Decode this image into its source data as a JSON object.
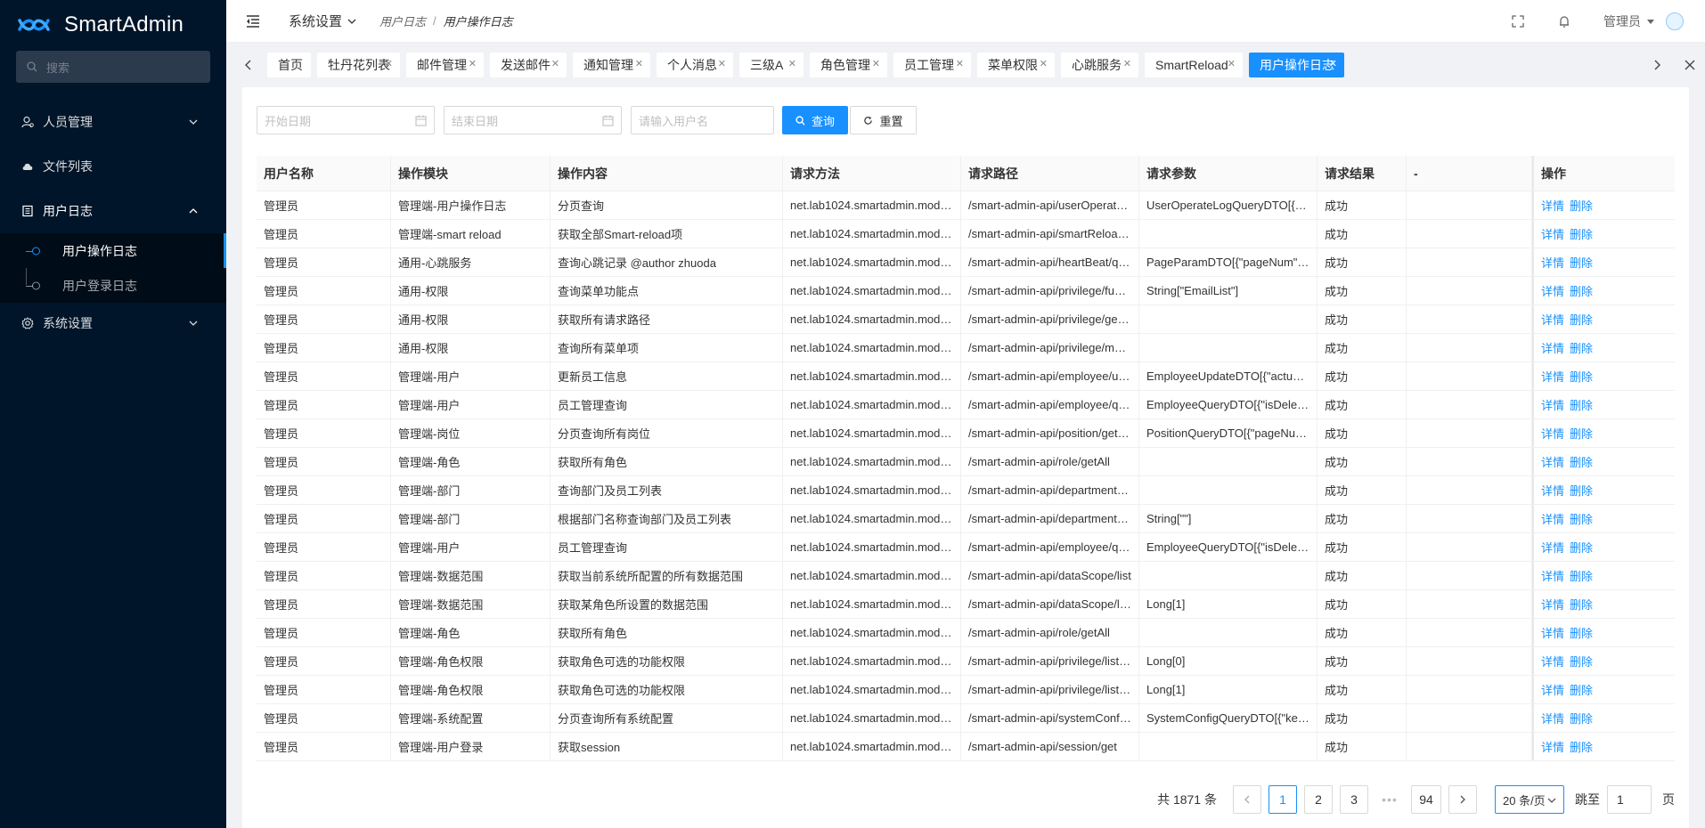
{
  "app": {
    "name": "SmartAdmin"
  },
  "sidebar": {
    "search_placeholder": "搜索",
    "menu": [
      {
        "label": "人员管理",
        "icon": "user-icon",
        "expanded": false
      },
      {
        "label": "文件列表",
        "icon": "cloud-icon"
      },
      {
        "label": "用户日志",
        "icon": "book-icon",
        "expanded": true
      },
      {
        "label": "系统设置",
        "icon": "gear-icon",
        "expanded": false
      }
    ],
    "submenu": [
      {
        "label": "用户操作日志",
        "active": true
      },
      {
        "label": "用户登录日志",
        "active": false
      }
    ]
  },
  "header": {
    "menu_label": "系统设置",
    "breadcrumb": [
      "用户日志",
      "用户操作日志"
    ],
    "user_name": "管理员"
  },
  "tabs": [
    {
      "label": "首页",
      "closable": false
    },
    {
      "label": "牡丹花列表",
      "closable": true
    },
    {
      "label": "邮件管理",
      "closable": true
    },
    {
      "label": "发送邮件",
      "closable": true
    },
    {
      "label": "通知管理",
      "closable": true
    },
    {
      "label": "个人消息",
      "closable": true
    },
    {
      "label": "三级A",
      "closable": true
    },
    {
      "label": "角色管理",
      "closable": true
    },
    {
      "label": "员工管理",
      "closable": true
    },
    {
      "label": "菜单权限",
      "closable": true
    },
    {
      "label": "心跳服务",
      "closable": true
    },
    {
      "label": "SmartReload",
      "closable": true
    },
    {
      "label": "用户操作日志",
      "closable": true,
      "active": true
    }
  ],
  "filters": {
    "start_date_placeholder": "开始日期",
    "end_date_placeholder": "结束日期",
    "username_placeholder": "请输入用户名",
    "query_label": "查询",
    "reset_label": "重置"
  },
  "table": {
    "columns": [
      "用户名称",
      "操作模块",
      "操作内容",
      "请求方法",
      "请求路径",
      "请求参数",
      "请求结果",
      "-",
      "操作"
    ],
    "action_detail": "详情",
    "action_delete": "删除",
    "rows": [
      [
        "管理员",
        "管理端-用户操作日志",
        "分页查询",
        "net.lab1024.smartadmin.modul...",
        "/smart-admin-api/userOperateL...",
        "UserOperateLogQueryDTO[{\"e...",
        "成功",
        ""
      ],
      [
        "管理员",
        "管理端-smart reload",
        "获取全部Smart-reload项",
        "net.lab1024.smartadmin.modul...",
        "/smart-admin-api/smartReload/all",
        "",
        "成功",
        ""
      ],
      [
        "管理员",
        "通用-心跳服务",
        "查询心跳记录 @author zhuoda",
        "net.lab1024.smartadmin.modul...",
        "/smart-admin-api/heartBeat/query",
        "PageParamDTO[{\"pageNum\":1,...",
        "成功",
        ""
      ],
      [
        "管理员",
        "通用-权限",
        "查询菜单功能点",
        "net.lab1024.smartadmin.modul...",
        "/smart-admin-api/privilege/functi...",
        "String[\"EmailList\"]",
        "成功",
        ""
      ],
      [
        "管理员",
        "通用-权限",
        "获取所有请求路径",
        "net.lab1024.smartadmin.modul...",
        "/smart-admin-api/privilege/getAl...",
        "",
        "成功",
        ""
      ],
      [
        "管理员",
        "通用-权限",
        "查询所有菜单项",
        "net.lab1024.smartadmin.modul...",
        "/smart-admin-api/privilege/men...",
        "",
        "成功",
        ""
      ],
      [
        "管理员",
        "管理端-用户",
        "更新员工信息",
        "net.lab1024.smartadmin.modul...",
        "/smart-admin-api/employee/upd...",
        "EmployeeUpdateDTO[{\"actualN...",
        "成功",
        ""
      ],
      [
        "管理员",
        "管理端-用户",
        "员工管理查询",
        "net.lab1024.smartadmin.modul...",
        "/smart-admin-api/employee/query",
        "EmployeeQueryDTO[{\"isDelete\"...",
        "成功",
        ""
      ],
      [
        "管理员",
        "管理端-岗位",
        "分页查询所有岗位",
        "net.lab1024.smartadmin.modul...",
        "/smart-admin-api/position/getLis...",
        "PositionQueryDTO[{\"pageNum\"...",
        "成功",
        ""
      ],
      [
        "管理员",
        "管理端-角色",
        "获取所有角色",
        "net.lab1024.smartadmin.modul...",
        "/smart-admin-api/role/getAll",
        "",
        "成功",
        ""
      ],
      [
        "管理员",
        "管理端-部门",
        "查询部门及员工列表",
        "net.lab1024.smartadmin.modul...",
        "/smart-admin-api/department/lis...",
        "",
        "成功",
        ""
      ],
      [
        "管理员",
        "管理端-部门",
        "根据部门名称查询部门及员工列表",
        "net.lab1024.smartadmin.modul...",
        "/smart-admin-api/department/lis...",
        "String[\"\"]",
        "成功",
        ""
      ],
      [
        "管理员",
        "管理端-用户",
        "员工管理查询",
        "net.lab1024.smartadmin.modul...",
        "/smart-admin-api/employee/query",
        "EmployeeQueryDTO[{\"isDelete\"...",
        "成功",
        ""
      ],
      [
        "管理员",
        "管理端-数据范围",
        "获取当前系统所配置的所有数据范围",
        "net.lab1024.smartadmin.modul...",
        "/smart-admin-api/dataScope/list",
        "",
        "成功",
        ""
      ],
      [
        "管理员",
        "管理端-数据范围",
        "获取某角色所设置的数据范围",
        "net.lab1024.smartadmin.modul...",
        "/smart-admin-api/dataScope/list...",
        "Long[1]",
        "成功",
        ""
      ],
      [
        "管理员",
        "管理端-角色",
        "获取所有角色",
        "net.lab1024.smartadmin.modul...",
        "/smart-admin-api/role/getAll",
        "",
        "成功",
        ""
      ],
      [
        "管理员",
        "管理端-角色权限",
        "获取角色可选的功能权限",
        "net.lab1024.smartadmin.modul...",
        "/smart-admin-api/privilege/listPri...",
        "Long[0]",
        "成功",
        ""
      ],
      [
        "管理员",
        "管理端-角色权限",
        "获取角色可选的功能权限",
        "net.lab1024.smartadmin.modul...",
        "/smart-admin-api/privilege/listPri...",
        "Long[1]",
        "成功",
        ""
      ],
      [
        "管理员",
        "管理端-系统配置",
        "分页查询所有系统配置",
        "net.lab1024.smartadmin.modul...",
        "/smart-admin-api/systemConfig/...",
        "SystemConfigQueryDTO[{\"key\":...",
        "成功",
        ""
      ],
      [
        "管理员",
        "管理端-用户登录",
        "获取session",
        "net.lab1024.smartadmin.modul...",
        "/smart-admin-api/session/get",
        "",
        "成功",
        ""
      ]
    ]
  },
  "pagination": {
    "total_text": "共 1871 条",
    "pages": [
      "1",
      "2",
      "3"
    ],
    "ellipsis": "•••",
    "last_page": "94",
    "current_page": "1",
    "page_size": "20 条/页",
    "jump_label": "跳至",
    "jump_value": "1",
    "page_suffix": "页"
  },
  "colors": {
    "sidebar_bg": "#001529",
    "accent": "#1890ff"
  }
}
